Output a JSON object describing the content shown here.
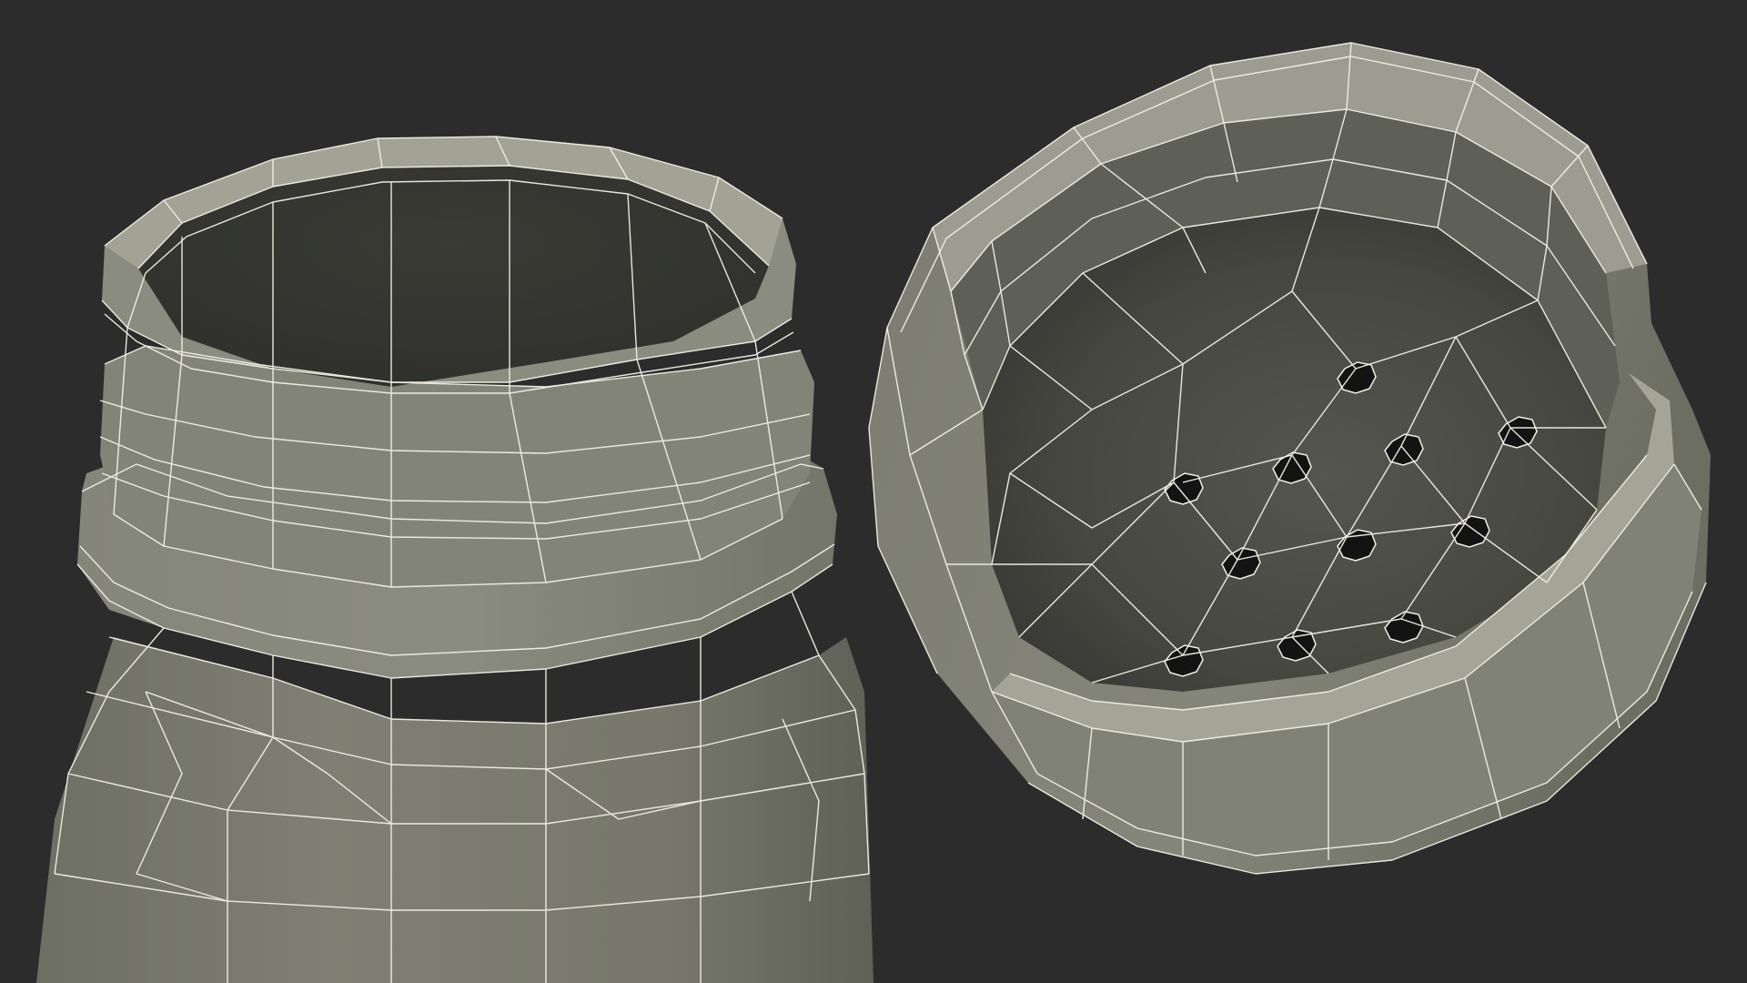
{
  "scene": {
    "background_color": "#2b2c2b",
    "surface_color": "#7d7e71",
    "surface_light_color": "#8e8f82",
    "surface_dark_color": "#4f5049",
    "interior_color": "#3a3b37",
    "hole_color": "#121312",
    "wire_color": "#f3f1e6"
  }
}
